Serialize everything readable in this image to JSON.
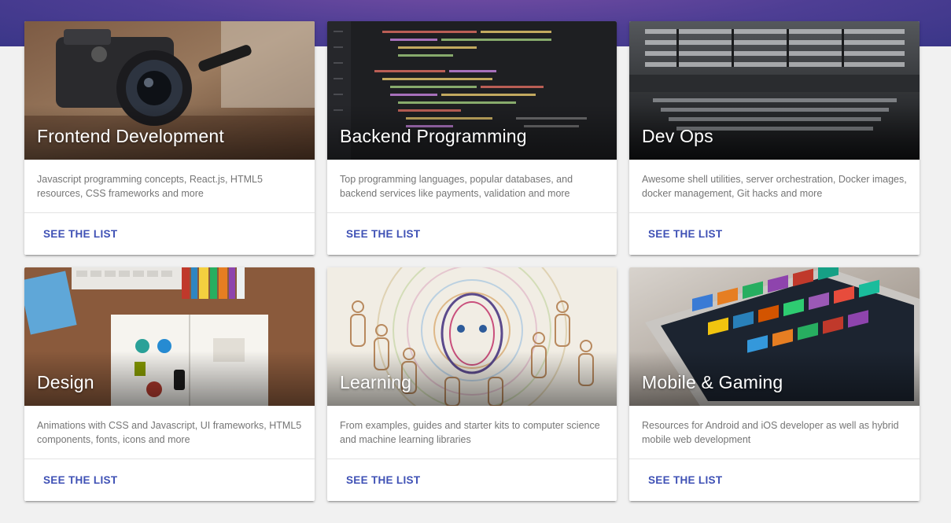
{
  "header": {
    "accent_color": "#4e3e94"
  },
  "cards": [
    {
      "title": "Frontend Development",
      "description": "Javascript programming concepts, React.js, HTML5 resources, CSS frameworks and more",
      "action_label": "SEE THE LIST",
      "image": "camera-photo"
    },
    {
      "title": "Backend Programming",
      "description": "Top programming languages, popular databases, and backend services like payments, validation and more",
      "action_label": "SEE THE LIST",
      "image": "code-editor-photo"
    },
    {
      "title": "Dev Ops",
      "description": "Awesome shell utilities, server orchestration, Docker images, docker management, Git hacks and more",
      "action_label": "SEE THE LIST",
      "image": "server-rack-photo"
    },
    {
      "title": "Design",
      "description": "Animations with CSS and Javascript, UI frameworks, HTML5 components, fonts, icons and more",
      "action_label": "SEE THE LIST",
      "image": "design-desk-photo"
    },
    {
      "title": "Learning",
      "description": "From examples, guides and starter kits to computer science and machine learning libraries",
      "action_label": "SEE THE LIST",
      "image": "ai-head-illustration"
    },
    {
      "title": "Mobile & Gaming",
      "description": "Resources for Android and iOS developer as well as hybrid mobile web development",
      "action_label": "SEE THE LIST",
      "image": "tablet-photo"
    }
  ],
  "colors": {
    "button_text": "#3f51b5",
    "page_background": "#f1f1f1"
  }
}
